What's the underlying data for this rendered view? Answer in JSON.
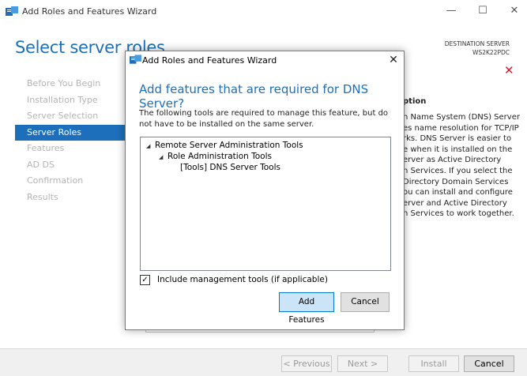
{
  "main_window": {
    "title": "Add Roles and Features Wizard",
    "controls": {
      "minimize": "—",
      "maximize": "☐",
      "close": "✕"
    },
    "page_title": "Select server roles",
    "destination_label": "DESTINATION SERVER",
    "destination_server": "WS2K22PDC",
    "error_icon": "✕"
  },
  "nav": {
    "items": [
      {
        "label": "Before You Begin",
        "active": false
      },
      {
        "label": "Installation Type",
        "active": false
      },
      {
        "label": "Server Selection",
        "active": false
      },
      {
        "label": "Server Roles",
        "active": true
      },
      {
        "label": "Features",
        "active": false
      },
      {
        "label": "AD DS",
        "active": false
      },
      {
        "label": "Confirmation",
        "active": false
      },
      {
        "label": "Results",
        "active": false
      }
    ]
  },
  "description": {
    "heading": "ption",
    "lines": [
      "n Name System (DNS) Server",
      "es name resolution for TCP/IP",
      "rks. DNS Server is easier to",
      "e when it is installed on the",
      "erver as Active Directory",
      "n Services. If you select the",
      "Directory Domain Services",
      "ou can install and configure",
      "erver and Active Directory",
      "n Services to work together."
    ]
  },
  "footer": {
    "previous": "< Previous",
    "next": "Next >",
    "install": "Install",
    "cancel": "Cancel"
  },
  "dialog": {
    "title": "Add Roles and Features Wizard",
    "close": "✕",
    "heading": "Add features that are required for DNS Server?",
    "body": "The following tools are required to manage this feature, but do not have to be installed on the same server.",
    "tree": [
      {
        "label": "Remote Server Administration Tools",
        "expanded": true
      },
      {
        "label": "Role Administration Tools",
        "expanded": true
      },
      {
        "label": "[Tools] DNS Server Tools",
        "expanded": false
      }
    ],
    "include_checked": true,
    "include_mark": "✓",
    "include_label": "Include management tools (if applicable)",
    "add_features": "Add Features",
    "cancel": "Cancel"
  },
  "colors": {
    "accent": "#1e6fbb",
    "error": "#e81123",
    "disabled_text": "#b5b5b5"
  },
  "icons": [
    "server-manager-icon",
    "close-icon",
    "minimize-icon",
    "maximize-icon",
    "expand-arrow-icon",
    "checkbox-check-icon"
  ]
}
